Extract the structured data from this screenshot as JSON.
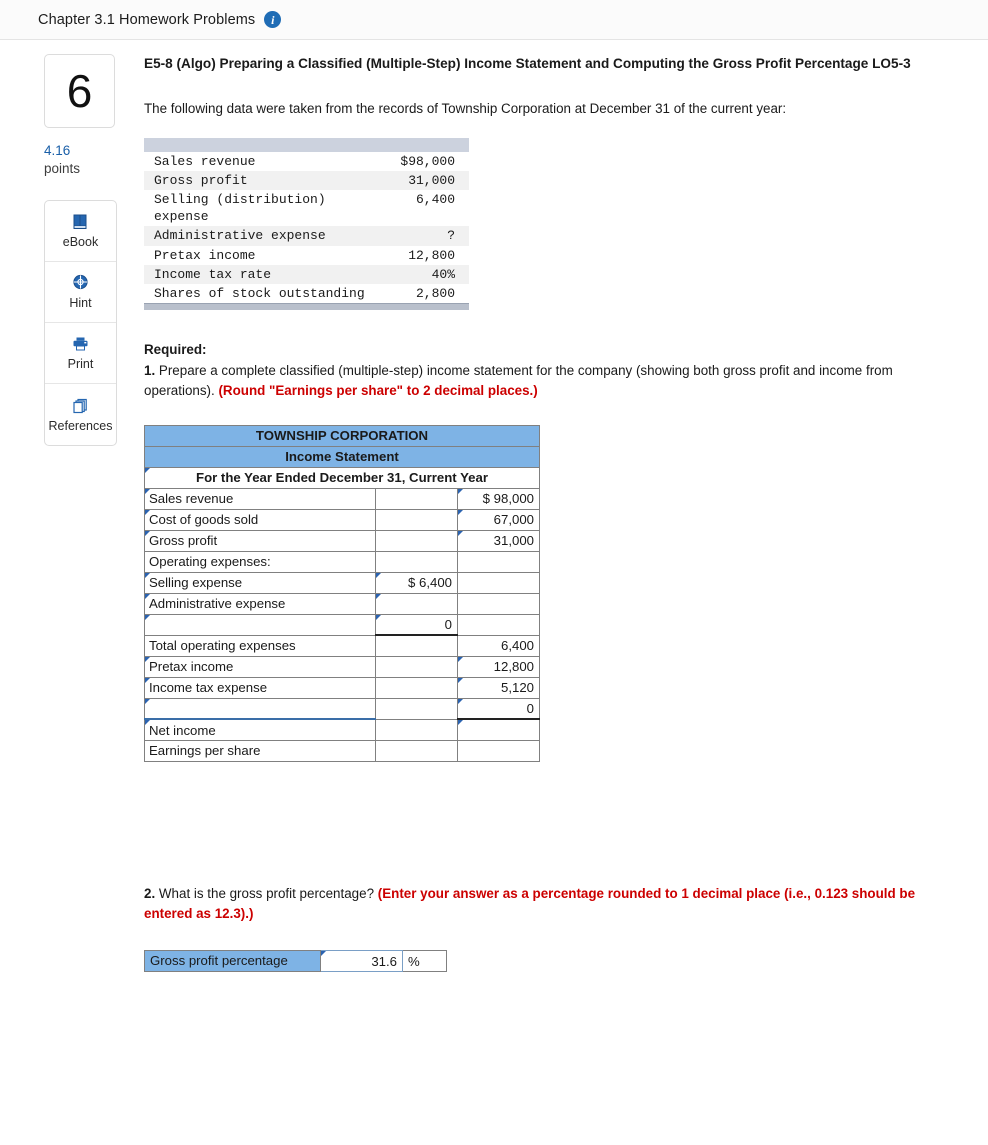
{
  "topbar": {
    "title": "Chapter 3.1 Homework Problems",
    "info_icon": "info-icon",
    "info_glyph": "i"
  },
  "rail": {
    "question_number": "6",
    "points_value": "4.16",
    "points_label": "points",
    "tools": [
      {
        "label": "eBook",
        "icon": "ebook-icon"
      },
      {
        "label": "Hint",
        "icon": "hint-icon"
      },
      {
        "label": "Print",
        "icon": "print-icon"
      },
      {
        "label": "References",
        "icon": "references-icon"
      }
    ]
  },
  "question": {
    "title": "E5-8 (Algo) Preparing a Classified (Multiple-Step) Income Statement and Computing the Gross Profit Percentage LO5-3",
    "intro": "The following data were taken from the records of Township Corporation at December 31 of the current year:"
  },
  "given_data": {
    "rows": [
      {
        "label": "Sales revenue",
        "value": "$98,000"
      },
      {
        "label": "Gross profit",
        "value": "31,000"
      },
      {
        "label": "Selling (distribution) expense",
        "value": "6,400"
      },
      {
        "label": "Administrative expense",
        "value": "?"
      },
      {
        "label": "Pretax income",
        "value": "12,800"
      },
      {
        "label": "Income tax rate",
        "value": "40%"
      },
      {
        "label": "Shares of stock outstanding",
        "value": "2,800"
      }
    ]
  },
  "required": {
    "heading": "Required:",
    "item1_num": "1.",
    "item1_text": "Prepare a complete classified (multiple-step) income statement for the company (showing both gross profit and income from operations).",
    "item1_red": "(Round \"Earnings per share\" to 2 decimal places.)"
  },
  "income_statement": {
    "header1": "TOWNSHIP CORPORATION",
    "header2": "Income Statement",
    "header3": "For the Year Ended December 31, Current Year",
    "rows": [
      {
        "label": "Sales revenue",
        "mid": "",
        "right": "$  98,000"
      },
      {
        "label": "Cost of goods sold",
        "mid": "",
        "right": "67,000"
      },
      {
        "label": "Gross profit",
        "mid": "",
        "right": "31,000"
      },
      {
        "label": "Operating expenses:",
        "mid": "",
        "right": ""
      },
      {
        "label": "Selling expense",
        "mid": "$    6,400",
        "right": ""
      },
      {
        "label": "Administrative expense",
        "mid": "",
        "right": ""
      },
      {
        "label": "",
        "mid": "0",
        "right": ""
      },
      {
        "label": "Total operating expenses",
        "mid": "",
        "right": "6,400"
      },
      {
        "label": "Pretax income",
        "mid": "",
        "right": "12,800"
      },
      {
        "label": "Income tax expense",
        "mid": "",
        "right": "5,120"
      },
      {
        "label": "",
        "mid": "",
        "right": "0"
      },
      {
        "label": "Net income",
        "mid": "",
        "right": ""
      },
      {
        "label": "Earnings per share",
        "mid": "",
        "right": ""
      }
    ]
  },
  "question2": {
    "num": "2.",
    "text": "What is the gross profit percentage?",
    "red": "(Enter your answer as a percentage rounded to 1 decimal place (i.e., 0.123 should be entered as 12.3).)",
    "label": "Gross profit percentage",
    "value": "31.6",
    "unit": "%"
  },
  "colors": {
    "accent_blue": "#7eb3e5",
    "link_blue": "#1a5fa8",
    "red": "#cc0000",
    "given_header": "#ccd2de"
  }
}
